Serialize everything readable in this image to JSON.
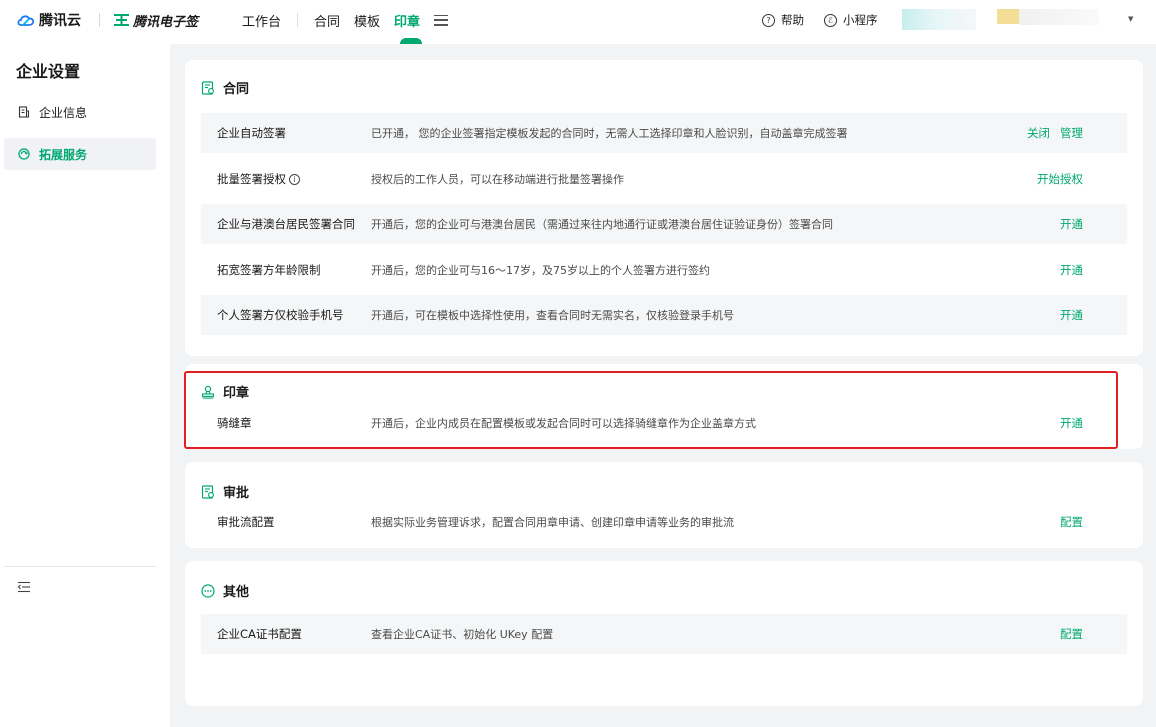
{
  "header": {
    "cloud_brand": "腾讯云",
    "ess_brand": "腾讯电子签",
    "nav": [
      "工作台",
      "合同",
      "模板",
      "印章"
    ],
    "active_nav": "印章",
    "help": "帮助",
    "mini_program": "小程序"
  },
  "sidebar": {
    "title": "企业设置",
    "items": [
      {
        "label": "企业信息",
        "icon": "building-icon"
      },
      {
        "label": "拓展服务",
        "icon": "extension-icon"
      }
    ]
  },
  "sections": {
    "contract": {
      "title": "合同",
      "rows": [
        {
          "name": "企业自动签署",
          "desc": "已开通， 您的企业签署指定模板发起的合同时，无需人工选择印章和人脸识别，自动盖章完成签署",
          "actions": [
            "关闭",
            "管理"
          ]
        },
        {
          "name": "批量签署授权",
          "desc": "授权后的工作人员，可以在移动端进行批量签署操作",
          "actions": [
            "开始授权"
          ]
        },
        {
          "name": "企业与港澳台居民签署合同",
          "desc": "开通后，您的企业可与港澳台居民（需通过来往内地通行证或港澳台居住证验证身份）签署合同",
          "actions": [
            "开通"
          ]
        },
        {
          "name": "拓宽签署方年龄限制",
          "desc": "开通后，您的企业可与16～17岁，及75岁以上的个人签署方进行签约",
          "actions": [
            "开通"
          ]
        },
        {
          "name": "个人签署方仅校验手机号",
          "desc": "开通后，可在模板中选择性使用，查看合同时无需实名，仅核验登录手机号",
          "actions": [
            "开通"
          ]
        }
      ]
    },
    "seal": {
      "title": "印章",
      "rows": [
        {
          "name": "骑缝章",
          "desc": "开通后，企业内成员在配置模板或发起合同时可以选择骑缝章作为企业盖章方式",
          "actions": [
            "开通"
          ]
        }
      ]
    },
    "approval": {
      "title": "审批",
      "rows": [
        {
          "name": "审批流配置",
          "desc": "根据实际业务管理诉求，配置合同用章申请、创建印章申请等业务的审批流",
          "actions": [
            "配置"
          ]
        }
      ]
    },
    "other": {
      "title": "其他",
      "rows": [
        {
          "name": "企业CA证书配置",
          "desc": "查看企业CA证书、初始化 UKey 配置",
          "actions": [
            "配置"
          ]
        }
      ]
    }
  },
  "colors": {
    "accent": "#00a870",
    "highlight": "#e02020",
    "page_bg": "#f2f3f5"
  }
}
